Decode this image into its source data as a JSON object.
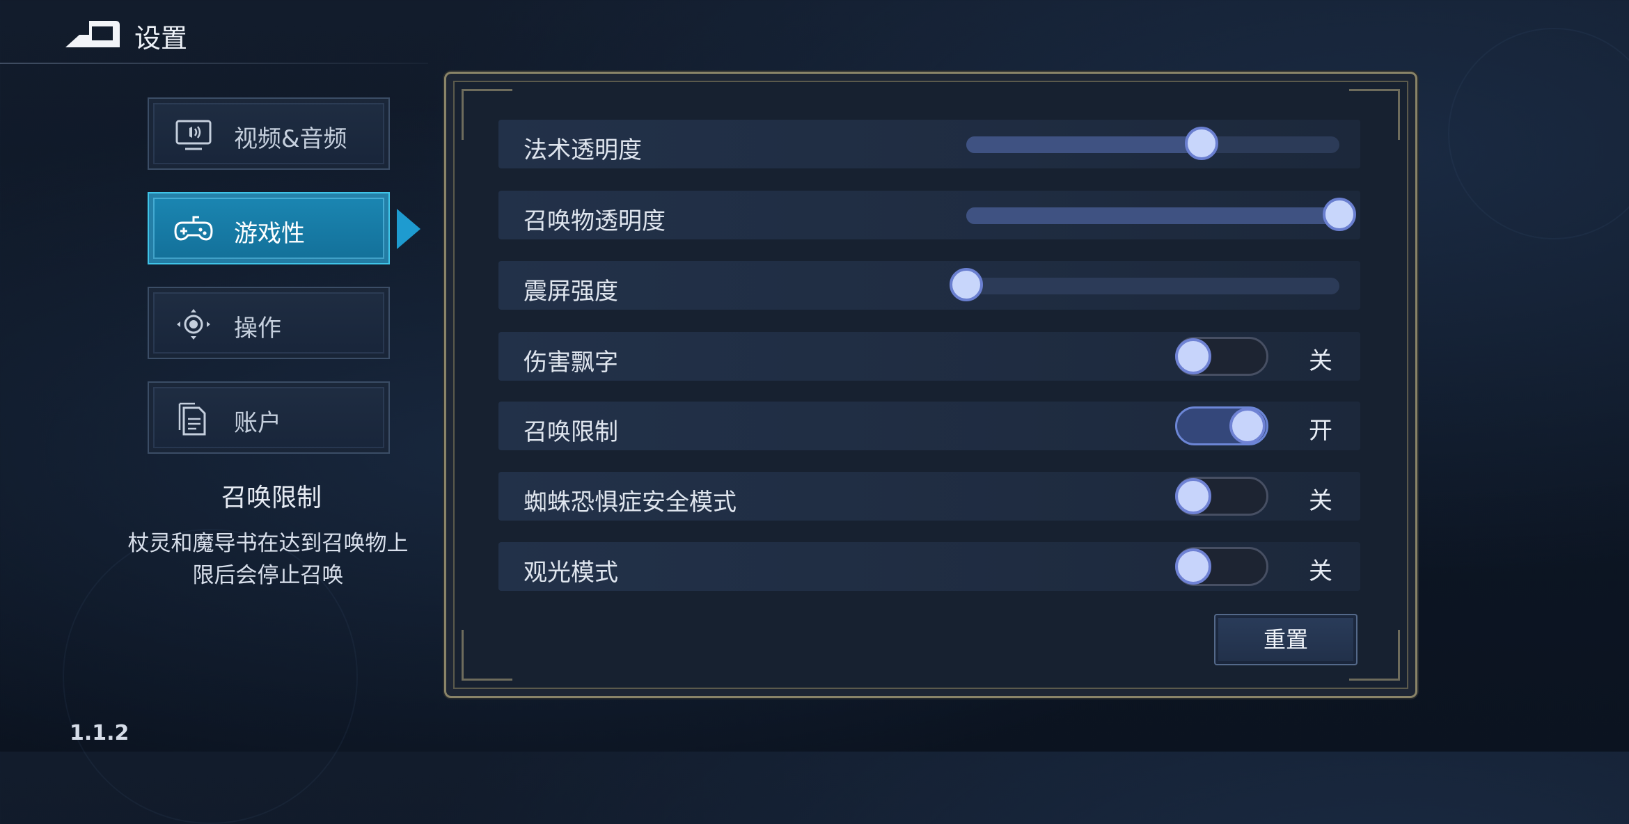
{
  "header": {
    "title": "设置",
    "back_icon": "back-arrow-icon"
  },
  "sidebar": {
    "tabs": [
      {
        "label": "视频&音频",
        "icon": "monitor-speaker-icon",
        "active": false
      },
      {
        "label": "游戏性",
        "icon": "gamepad-icon",
        "active": true
      },
      {
        "label": "操作",
        "icon": "joystick-icon",
        "active": false
      },
      {
        "label": "账户",
        "icon": "document-icon",
        "active": false
      }
    ]
  },
  "description": {
    "title": "召唤限制",
    "line1": "杖灵和魔导书在达到召唤物上",
    "line2": "限后会停止召唤"
  },
  "version": "1.1.2",
  "settings": {
    "sliders": [
      {
        "label": "法术透明度",
        "value": 0.63
      },
      {
        "label": "召唤物透明度",
        "value": 1.0
      },
      {
        "label": "震屏强度",
        "value": 0.0
      }
    ],
    "toggles": [
      {
        "label": "伤害飘字",
        "on": false,
        "state_text": "关"
      },
      {
        "label": "召唤限制",
        "on": true,
        "state_text": "开"
      },
      {
        "label": "蜘蛛恐惧症安全模式",
        "on": false,
        "state_text": "关"
      },
      {
        "label": "观光模式",
        "on": false,
        "state_text": "关"
      }
    ],
    "reset_label": "重置"
  },
  "colors": {
    "accent": "#1e9bd0",
    "knob": "#c8d6fb",
    "panel_border": "#8a8468"
  }
}
